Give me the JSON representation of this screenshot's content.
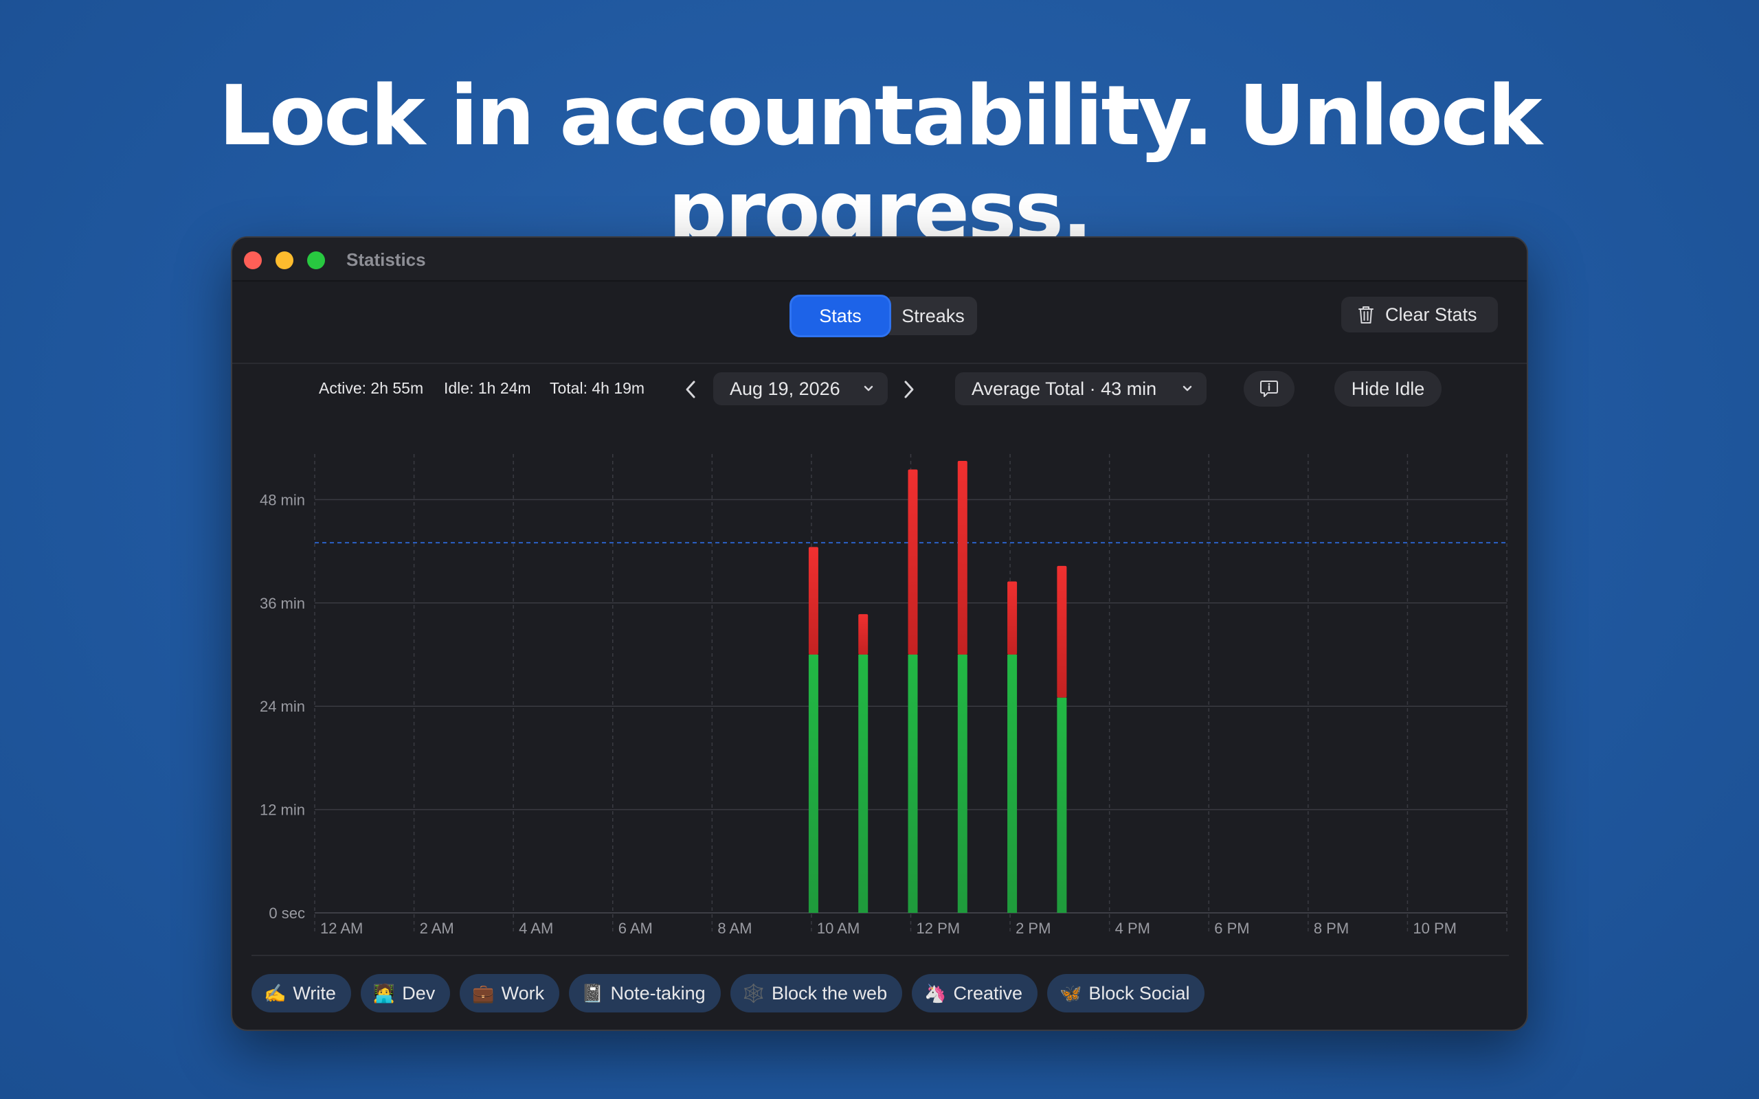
{
  "hero": {
    "headline": "Lock in accountability. Unlock progress."
  },
  "window": {
    "title": "Statistics"
  },
  "tabs": [
    {
      "label": "Stats",
      "selected": true
    },
    {
      "label": "Streaks",
      "selected": false
    }
  ],
  "toolbar": {
    "clear_label": "Clear Stats",
    "clear_icon": "trash-icon"
  },
  "summary": {
    "active": "Active: 2h 55m",
    "idle": "Idle: 1h 24m",
    "total": "Total: 4h 19m"
  },
  "date_picker": {
    "value": "Aug 19, 2026"
  },
  "average_select": {
    "value": "Average Total · 43 min"
  },
  "hide_idle_label": "Hide Idle",
  "colors": {
    "active": "#22b845",
    "idle": "#e02b2b",
    "accent": "#1d63e8",
    "average_line": "#2f73f0"
  },
  "chart_data": {
    "type": "bar",
    "stacked": true,
    "y_unit": "minutes",
    "y_ticks": [
      {
        "value": 0,
        "label": "0 sec"
      },
      {
        "value": 12,
        "label": "12 min"
      },
      {
        "value": 24,
        "label": "24 min"
      },
      {
        "value": 36,
        "label": "36 min"
      },
      {
        "value": 48,
        "label": "48 min"
      }
    ],
    "ylim": [
      0,
      52.5
    ],
    "x_hours": [
      0,
      2,
      4,
      6,
      8,
      10,
      12,
      14,
      16,
      18,
      20,
      22
    ],
    "x_labels": [
      "12 AM",
      "2 AM",
      "4 AM",
      "6 AM",
      "8 AM",
      "10 AM",
      "12 PM",
      "2 PM",
      "4 PM",
      "6 PM",
      "8 PM",
      "10 PM"
    ],
    "xlim": [
      0,
      24
    ],
    "average_line_value": 43,
    "grid": true,
    "series": [
      {
        "key": "active",
        "hours": [
          10,
          11,
          12,
          13,
          14,
          15
        ],
        "values": [
          30,
          30,
          30,
          30,
          30,
          25
        ]
      },
      {
        "key": "idle",
        "hours": [
          10,
          11,
          12,
          13,
          14,
          15
        ],
        "values": [
          12.5,
          4.7,
          21.5,
          22.5,
          8.5,
          15.3
        ]
      }
    ]
  },
  "profiles": [
    {
      "emoji": "✍️",
      "label": "Write"
    },
    {
      "emoji": "🧑‍💻",
      "label": "Dev"
    },
    {
      "emoji": "💼",
      "label": "Work"
    },
    {
      "emoji": "📓",
      "label": "Note-taking"
    },
    {
      "emoji": "🕸️",
      "label": "Block the web"
    },
    {
      "emoji": "🦄",
      "label": "Creative"
    },
    {
      "emoji": "🦋",
      "label": "Block Social"
    }
  ]
}
